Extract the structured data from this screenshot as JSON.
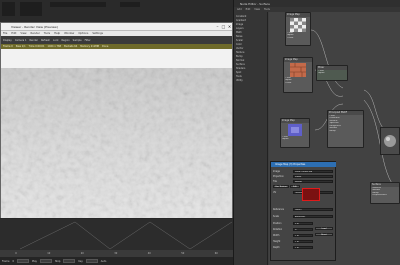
{
  "viewer": {
    "title": "Viewer - Render View (Preview)",
    "menu": [
      "File",
      "Edit",
      "View",
      "Render",
      "Tools",
      "Help",
      "Window",
      "Options",
      "Settings"
    ],
    "toolbar": [
      "Display",
      "Camera 1",
      "Render",
      "Refresh",
      "Lock",
      "Region",
      "Sample",
      "Filter"
    ],
    "status": [
      "Frame 0",
      "Pass 1/1",
      "Time 0:00:01",
      "1024 x 768",
      "Buckets 64",
      "Memory 212MB",
      "Done"
    ],
    "close_glyph": "✕",
    "min_glyph": "–",
    "max_glyph": "□"
  },
  "timeline": {
    "ruler": [
      "0",
      "10",
      "20",
      "30",
      "40",
      "50",
      "60"
    ],
    "controls": [
      "Frame",
      "0",
      "Play",
      "Stop",
      "Key",
      "Auto"
    ]
  },
  "node_editor": {
    "title": "Node Editor - Surface",
    "menu": [
      "Add",
      "Edit",
      "View",
      "Tools"
    ],
    "sidebar_items": [
      "Constant",
      "Gradient",
      "Image",
      "Layers",
      "Math",
      "Noise",
      "Scalar",
      "Color",
      "Vector",
      "Texture",
      "Bump",
      "Normal",
      "Surface",
      "Shaders",
      "Spot",
      "Tools",
      "Utility"
    ],
    "nodes": [
      {
        "name": "Image Map",
        "rows": [
          "Color",
          "Alpha",
          "Luma",
          "Bump"
        ]
      },
      {
        "name": "Image Map",
        "rows": [
          "Color",
          "Alpha",
          "Luma",
          "Bump"
        ]
      },
      {
        "name": "Mixer",
        "rows": [
          "Color",
          "Alpha"
        ]
      },
      {
        "name": "Principled BSDF",
        "rows": [
          "Color",
          "Luminous",
          "Metallic",
          "Specular",
          "Roughness",
          "Normal",
          "Bump"
        ]
      },
      {
        "name": "Image Map",
        "rows": [
          "Color",
          "Alpha",
          "Luma"
        ]
      },
      {
        "name": "Surface",
        "rows": [
          "Material",
          "Normal",
          "Bump",
          "Displacement"
        ]
      }
    ]
  },
  "properties": {
    "title": "Image Map (3) Properties",
    "labels": [
      "Image",
      "Projection",
      "Tile",
      "UV",
      "Reference",
      "Scale",
      "Position",
      "Rotation",
      "Width",
      "Height",
      "Depth"
    ],
    "fields": [
      "Snow_Diffuse.jpg",
      "Planar",
      "Repeat",
      "Texture",
      "(none)",
      "Automatic",
      "0 m",
      "0°",
      "1 m",
      "1 m",
      "1 m"
    ],
    "buttons": [
      "Use Texture",
      "Edit",
      "Load",
      "Reset"
    ]
  },
  "colors": {
    "highlight": "#e01a1a",
    "title_active": "#2d6fb3",
    "status_bar": "#6e6a2a"
  }
}
